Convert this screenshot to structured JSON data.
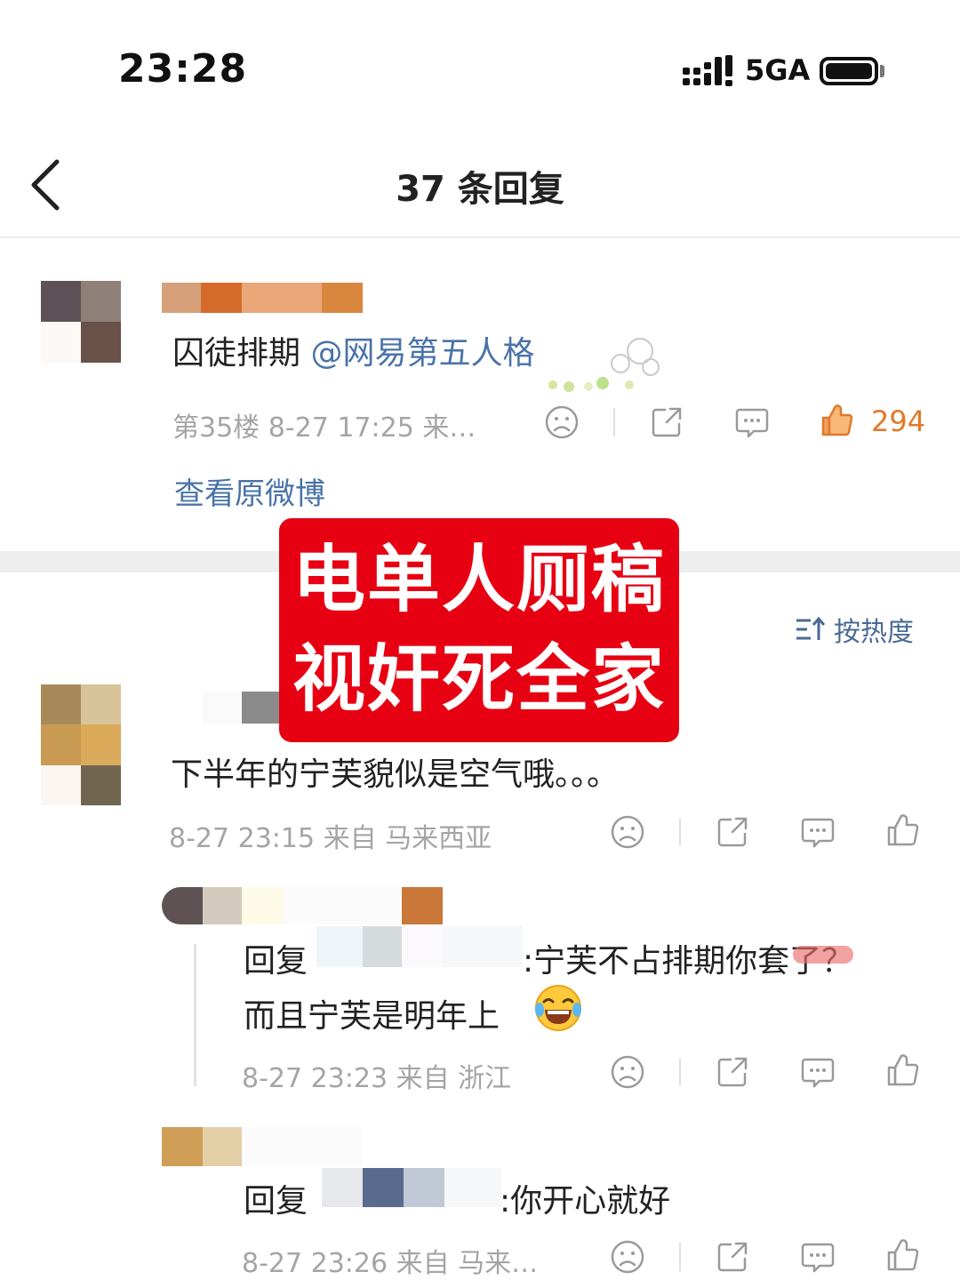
{
  "status_bar": {
    "time": "23:28",
    "network": "5GA"
  },
  "nav": {
    "title": "37 条回复"
  },
  "main_comment": {
    "text_prefix": "囚徒排期 ",
    "mention": "@网易第五人格",
    "meta": "第35楼 8-27 17:25 来…",
    "like_count": "294",
    "view_original": "查看原微博"
  },
  "overlay": {
    "line1": "电单人厕稿",
    "line2": "视奸死全家"
  },
  "sort": {
    "label": "按热度"
  },
  "comments": [
    {
      "text": "下半年的宁芙貌似是空气哦。。。",
      "meta": "8-27 23:15 来自 马来西亚"
    },
    {
      "reply_prefix": "回复",
      "text_line1": ":宁芙不占排期你套了？",
      "text_line2": "而且宁芙是明年上",
      "meta": "8-27 23:23 来自 浙江"
    },
    {
      "reply_prefix": "回复",
      "text_line1": ":你开心就好",
      "meta": "8-27 23:26 来自 马来…"
    }
  ],
  "colors": {
    "link": "#4a73a8",
    "like_active": "#e07a2c",
    "overlay": "#e60012",
    "meta": "#a5a5a5"
  },
  "icons": [
    "back-arrow-icon",
    "signal-icon",
    "battery-icon",
    "dislike-face-icon",
    "share-icon",
    "comment-icon",
    "thumbs-up-icon",
    "sort-icon",
    "laughing-emoji-icon"
  ]
}
